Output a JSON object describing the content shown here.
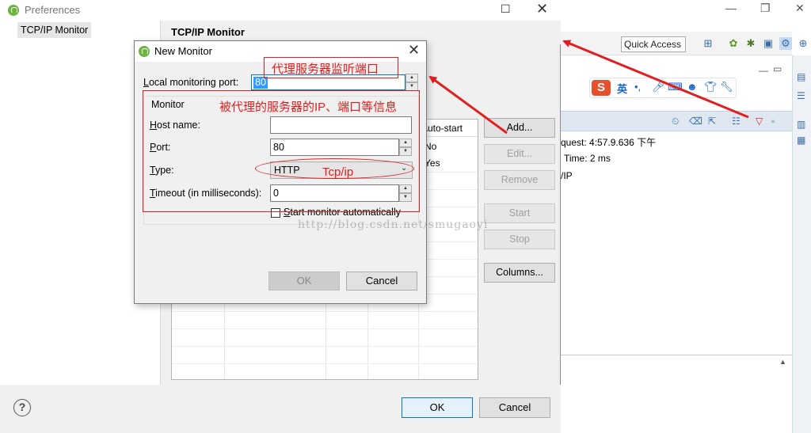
{
  "preferences": {
    "title": "Preferences",
    "tree_item": "TCP/IP Monitor",
    "page_title": "TCP/IP Monitor",
    "table": {
      "col_auto_start": "Auto-start",
      "values": [
        "No",
        "Yes"
      ]
    },
    "buttons": {
      "add": "Add...",
      "edit": "Edit...",
      "remove": "Remove",
      "start": "Start",
      "stop": "Stop",
      "columns": "Columns..."
    },
    "help": "?",
    "ok": "OK",
    "cancel": "Cancel"
  },
  "new_monitor": {
    "title": "New Monitor",
    "local_port_label_prefix": "L",
    "local_port_label_rest": "ocal monitoring port:",
    "local_port_value": "80",
    "group_label": "Monitor",
    "host_label_prefix": "H",
    "host_label_rest": "ost name:",
    "host_value": "",
    "port_label_prefix": "P",
    "port_label_rest": "ort:",
    "port_value": "80",
    "type_label_prefix": "T",
    "type_label_rest": "ype:",
    "type_value": "HTTP",
    "timeout_label_prefix": "T",
    "timeout_label_rest": "imeout (in milliseconds):",
    "timeout_value": "0",
    "auto_start_prefix": "S",
    "auto_start_rest": "tart monitor automatically",
    "ok": "OK",
    "cancel": "Cancel"
  },
  "annotations": {
    "listen_port": "代理服务器监听端口",
    "proxied_info": "被代理的服务器的IP、端口等信息",
    "type_note": "Tcp/ip"
  },
  "background": {
    "quick_access": "Quick Access",
    "ime_label": "英",
    "request_text": "quest: 4:57.9.636 下午",
    "time_text": "Time: 2 ms",
    "ip_text": "/IP"
  },
  "watermark": "http://blog.csdn.net/smugaoyi",
  "colors": {
    "annotation_red": "#e02020",
    "selection_blue": "#3399ff",
    "ok_focus_border": "#0078d7"
  }
}
